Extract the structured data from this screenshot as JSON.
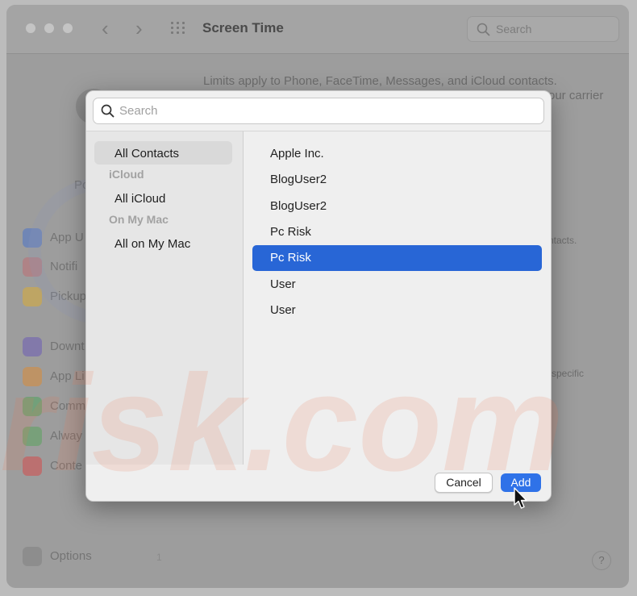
{
  "window": {
    "title": "Screen Time",
    "search_placeholder": "Search"
  },
  "background": {
    "limits_text": "Limits apply to Phone, FaceTime, Messages, and iCloud contacts.",
    "carrier_fragment": "our carrier",
    "contacts_fragment": "ntacts.",
    "specific_fragment": "specific",
    "po_fragment": "Po",
    "options_label": "Options",
    "options_count": "1",
    "help_label": "?",
    "sidebar_items": [
      {
        "label": "App U",
        "color": "#4a73c9"
      },
      {
        "label": "Notifi",
        "color": "#d2545b"
      },
      {
        "label": "Pickup",
        "color": "#d8ab35"
      },
      {
        "label": "Downt",
        "color": "#6c5bb5"
      },
      {
        "label": "App Li",
        "color": "#d98a37"
      },
      {
        "label": "Comm",
        "color": "#4fa35c"
      },
      {
        "label": "Alway",
        "color": "#5aa35c"
      },
      {
        "label": "Conte",
        "color": "#d34b4b"
      }
    ]
  },
  "watermark": {
    "line1": "PC",
    "line2": "risk.com"
  },
  "picker": {
    "search_placeholder": "Search",
    "sidebar": [
      {
        "type": "item",
        "label": "All Contacts",
        "selected": true
      },
      {
        "type": "header",
        "label": "iCloud"
      },
      {
        "type": "item",
        "label": "All iCloud"
      },
      {
        "type": "header",
        "label": "On My Mac"
      },
      {
        "type": "item",
        "label": "All on My Mac"
      }
    ],
    "contacts": [
      {
        "label": "Apple Inc."
      },
      {
        "label": "BlogUser2"
      },
      {
        "label": "BlogUser2"
      },
      {
        "label": "Pc Risk"
      },
      {
        "label": "Pc Risk",
        "selected": true
      },
      {
        "label": "User"
      },
      {
        "label": "User"
      }
    ],
    "cancel_label": "Cancel",
    "add_label": "Add"
  },
  "colors": {
    "selection": "#2866d6",
    "add_button": "#2f72e8"
  }
}
